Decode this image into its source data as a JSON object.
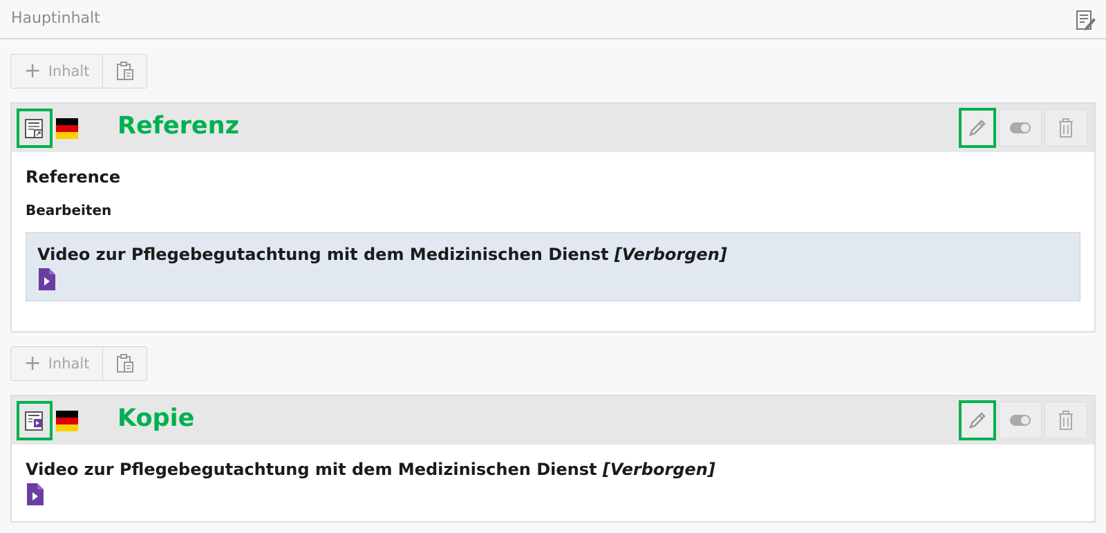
{
  "column": {
    "title": "Hauptinhalt"
  },
  "add_content": {
    "label": "Inhalt"
  },
  "elements": [
    {
      "label": "Referenz",
      "heading": "Reference",
      "subheading": "Bearbeiten",
      "reference": {
        "title": "Video zur Pflegebegutachtung mit dem Medizinischen Dienst",
        "status": "[Verborgen]"
      }
    },
    {
      "label": "Kopie",
      "content": {
        "title": "Video zur Pflegebegutachtung mit dem Medizinischen Dienst",
        "status": "[Verborgen]"
      }
    }
  ],
  "colors": {
    "highlight": "#00b050",
    "video_icon": "#6a3ea1"
  },
  "icons": {
    "column_edit": "page-edit-icon",
    "add": "plus-icon",
    "paste": "clipboard-icon",
    "type_reference": "content-shortcut-icon",
    "type_copy": "content-media-icon",
    "language": "german-flag-icon",
    "edit": "pencil-icon",
    "toggle": "toggle-icon",
    "delete": "trash-icon",
    "video": "video-file-icon"
  }
}
